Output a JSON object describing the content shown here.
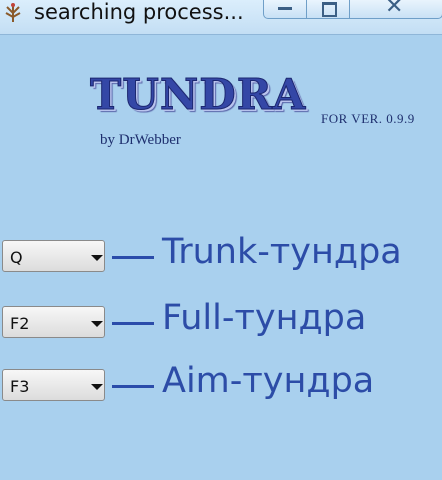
{
  "window": {
    "title": "searching process...",
    "controls": {
      "minimize_icon": "minimize-icon",
      "maximize_icon": "maximize-icon",
      "close_glyph": "✕"
    }
  },
  "logo": {
    "title": "TUNDRA",
    "version": "FOR VER. 0.9.9",
    "author": "by DrWebber"
  },
  "bindings": [
    {
      "key": "Q",
      "label": "Trunk-тундра"
    },
    {
      "key": "F2",
      "label": "Full-тундра"
    },
    {
      "key": "F3",
      "label": "Aim-тундра"
    }
  ],
  "colors": {
    "background": "#a9d0ee",
    "label": "#2c4ca7",
    "logo": "#3447a6"
  }
}
